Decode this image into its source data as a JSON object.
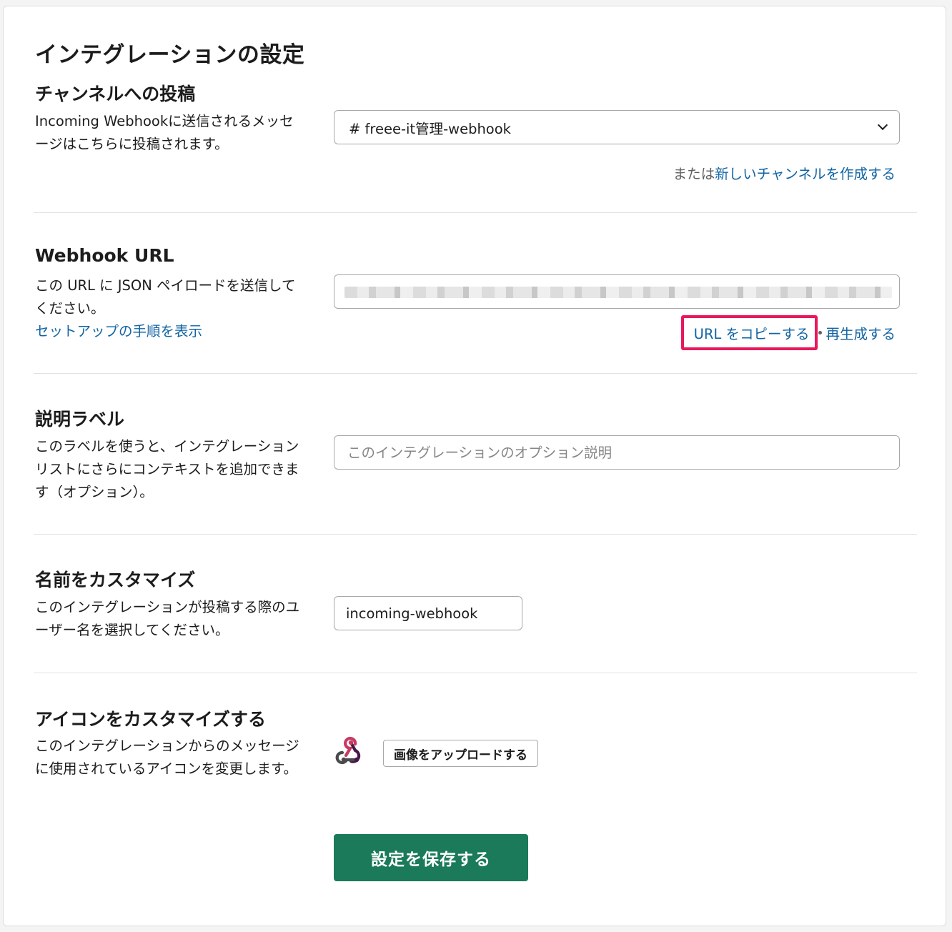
{
  "page": {
    "title": "インテグレーションの設定"
  },
  "channel": {
    "title": "チャンネルへの投稿",
    "description": "Incoming Webhookに送信されるメッセージはこちらに投稿されます。",
    "selected": "# freee-it管理-webhook",
    "or_text": "または",
    "create_link": "新しいチャンネルを作成する"
  },
  "webhook": {
    "title": "Webhook URL",
    "description": "この URL に JSON ペイロードを送信してください。",
    "setup_link": "セットアップの手順を表示",
    "copy_link": "URL をコピーする",
    "regenerate_link": "再生成する"
  },
  "label": {
    "title": "説明ラベル",
    "description": "このラベルを使うと、インテグレーションリストにさらにコンテキストを追加できます（オプション）。",
    "placeholder": "このインテグレーションのオプション説明"
  },
  "name": {
    "title": "名前をカスタマイズ",
    "description": "このインテグレーションが投稿する際のユーザー名を選択してください。",
    "value": "incoming-webhook"
  },
  "icon": {
    "title": "アイコンをカスタマイズする",
    "description": "このインテグレーションからのメッセージに使用されているアイコンを変更します。",
    "icon_name": "webhook-icon",
    "upload_label": "画像をアップロードする"
  },
  "actions": {
    "save_label": "設定を保存する"
  },
  "colors": {
    "link": "#1264a3",
    "save_button": "#1a7a5a",
    "highlight": "#e8185b"
  }
}
